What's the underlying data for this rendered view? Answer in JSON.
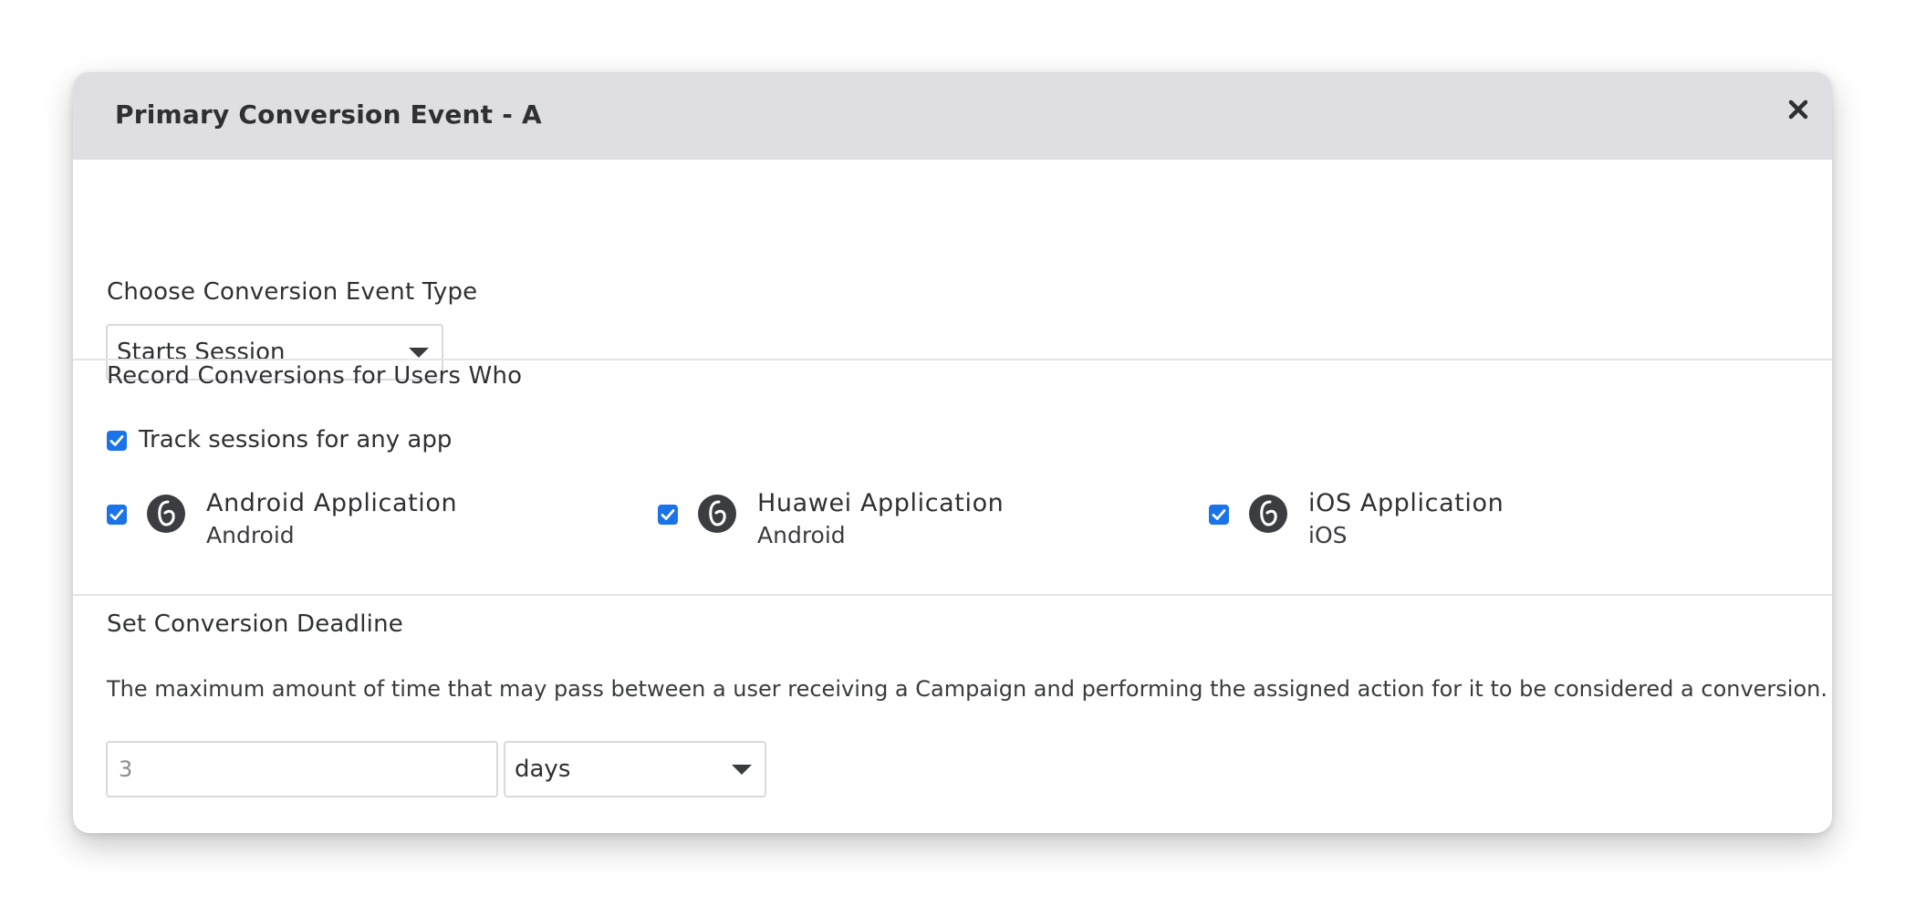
{
  "modal": {
    "title": "Primary Conversion Event - A",
    "close_icon": "close-icon"
  },
  "event_type": {
    "label": "Choose Conversion Event Type",
    "selected": "Starts Session"
  },
  "record": {
    "label": "Record Conversions for Users Who",
    "any_app_label": "Track sessions for any app",
    "any_app_checked": true,
    "apps": [
      {
        "name": "Android Application",
        "platform": "Android",
        "checked": true,
        "icon": "braze-logo-icon"
      },
      {
        "name": "Huawei Application",
        "platform": "Android",
        "checked": true,
        "icon": "braze-logo-icon"
      },
      {
        "name": "iOS Application",
        "platform": "iOS",
        "checked": true,
        "icon": "braze-logo-icon"
      }
    ]
  },
  "deadline": {
    "label": "Set Conversion Deadline",
    "description": "The maximum amount of time that may pass between a user receiving a Campaign and performing the assigned action for it to be considered a conversion.",
    "amount": "3",
    "unit": "days"
  },
  "colors": {
    "header_bg": "#dfdfe3",
    "checkbox": "#1a73e8",
    "text": "#2f3033"
  }
}
